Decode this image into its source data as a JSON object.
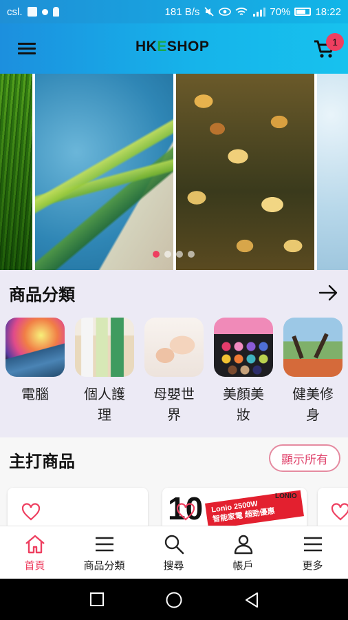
{
  "status_bar": {
    "carrier": "csl.",
    "network_speed": "181 B/s",
    "battery": "70%",
    "time": "18:22",
    "icons": [
      "image-icon",
      "notification-dot-icon",
      "key-icon",
      "mute-icon",
      "eye-icon",
      "wifi-icon",
      "signal-icon",
      "battery-icon"
    ]
  },
  "app_bar": {
    "logo_part1": "HK",
    "logo_part2": "E",
    "logo_part3": "SHOP",
    "cart_count": "1",
    "menu_icon": "hamburger-icon",
    "cart_icon": "cart-icon"
  },
  "banner": {
    "slides": [
      "grass",
      "palm",
      "leaves",
      "frost"
    ],
    "active_dot": 0,
    "dot_count": 4
  },
  "categories": {
    "title": "商品分類",
    "arrow_icon": "arrow-right-icon",
    "items": [
      {
        "label": "電腦"
      },
      {
        "label": "個人護理"
      },
      {
        "label": "母嬰世界"
      },
      {
        "label": "美顏美妝"
      },
      {
        "label": "健美修身"
      }
    ]
  },
  "featured": {
    "title": "主打商品",
    "show_all": "顯示所有",
    "product2": {
      "big_number": "10",
      "promo_line1": "Lonio 2500W",
      "promo_line2": "智能家電 超勁優惠",
      "brand": "LONIO"
    }
  },
  "bottom_nav": {
    "items": [
      {
        "label": "首頁",
        "icon": "home-icon",
        "active": true
      },
      {
        "label": "商品分類",
        "icon": "list-icon",
        "active": false
      },
      {
        "label": "搜尋",
        "icon": "search-icon",
        "active": false
      },
      {
        "label": "帳戶",
        "icon": "user-icon",
        "active": false
      },
      {
        "label": "更多",
        "icon": "more-icon",
        "active": false
      }
    ]
  },
  "colors": {
    "accent": "#ee3f60",
    "appbar_start": "#1c8fde",
    "appbar_end": "#17c2ee",
    "logo_green": "#1ca84a"
  }
}
